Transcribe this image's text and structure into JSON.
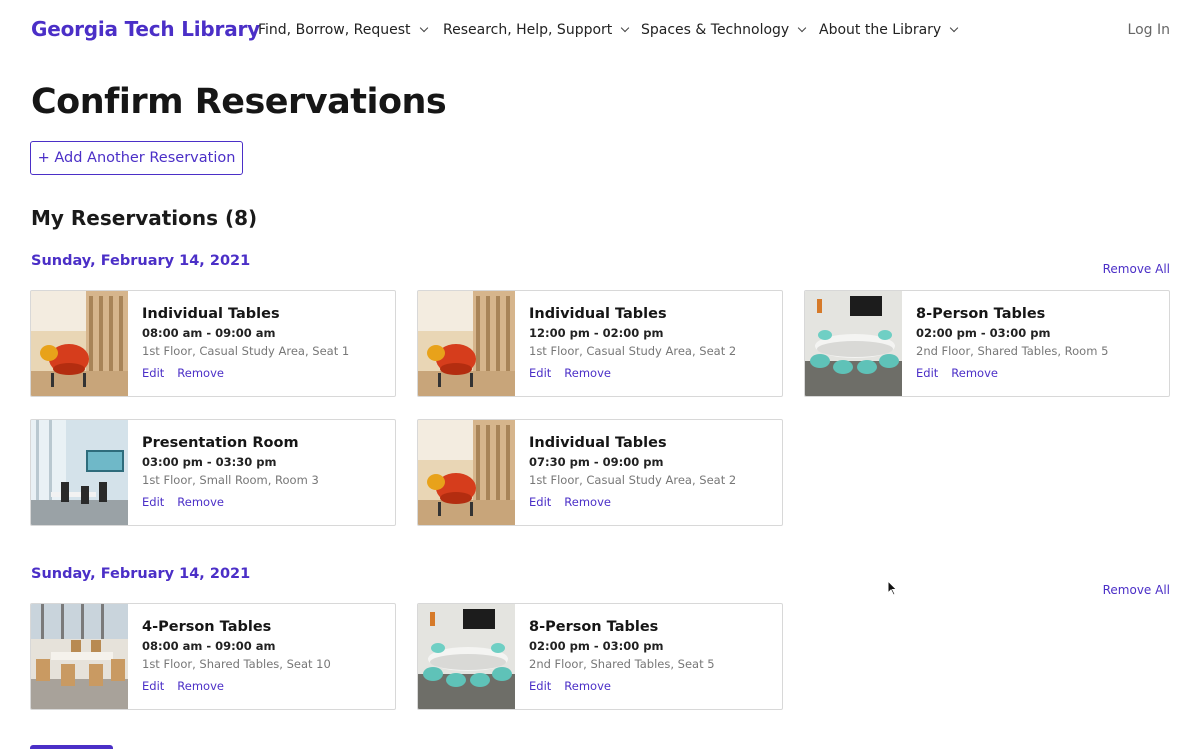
{
  "nav": {
    "brand": "Georgia Tech Library",
    "items": [
      {
        "label": "Find, Borrow, Request"
      },
      {
        "label": "Research, Help, Support"
      },
      {
        "label": "Spaces & Technology"
      },
      {
        "label": "About the Library"
      }
    ],
    "login": "Log In"
  },
  "page": {
    "title": "Confirm Reservations",
    "add_button": "+ Add Another Reservation",
    "section_title": "My Reservations (8)"
  },
  "groups": [
    {
      "date": "Sunday, February 14, 2021",
      "remove_all": "Remove All",
      "reservations": [
        {
          "title": "Individual Tables",
          "time": "08:00 am - 09:00 am",
          "location": "1st Floor, Casual Study Area, Seat 1",
          "image": "casual-study-photo",
          "edit": "Edit",
          "remove": "Remove"
        },
        {
          "title": "Individual Tables",
          "time": "12:00 pm - 02:00 pm",
          "location": "1st Floor, Casual Study Area, Seat 2",
          "image": "casual-study-photo",
          "edit": "Edit",
          "remove": "Remove"
        },
        {
          "title": "8-Person Tables",
          "time": "02:00 pm - 03:00 pm",
          "location": "2nd Floor, Shared Tables, Room 5",
          "image": "conference-room-photo",
          "edit": "Edit",
          "remove": "Remove"
        },
        {
          "title": "Presentation Room",
          "time": "03:00 pm - 03:30 pm",
          "location": "1st Floor, Small Room, Room 3",
          "image": "presentation-room-photo",
          "edit": "Edit",
          "remove": "Remove"
        },
        {
          "title": "Individual Tables",
          "time": "07:30 pm - 09:00 pm",
          "location": "1st Floor, Casual Study Area, Seat 2",
          "image": "casual-study-photo",
          "edit": "Edit",
          "remove": "Remove"
        }
      ]
    },
    {
      "date": "Sunday, February 14, 2021",
      "remove_all": "Remove All",
      "reservations": [
        {
          "title": "4-Person Tables",
          "time": "08:00 am - 09:00 am",
          "location": "1st Floor, Shared Tables, Seat 10",
          "image": "shared-tables-photo",
          "edit": "Edit",
          "remove": "Remove"
        },
        {
          "title": "8-Person Tables",
          "time": "02:00 pm - 03:00 pm",
          "location": "2nd Floor, Shared Tables, Seat 5",
          "image": "conference-room-photo",
          "edit": "Edit",
          "remove": "Remove"
        }
      ]
    }
  ],
  "colors": {
    "accent": "#4b2fc7",
    "text": "#161616",
    "muted": "#777777",
    "border": "#d8d8d8"
  }
}
